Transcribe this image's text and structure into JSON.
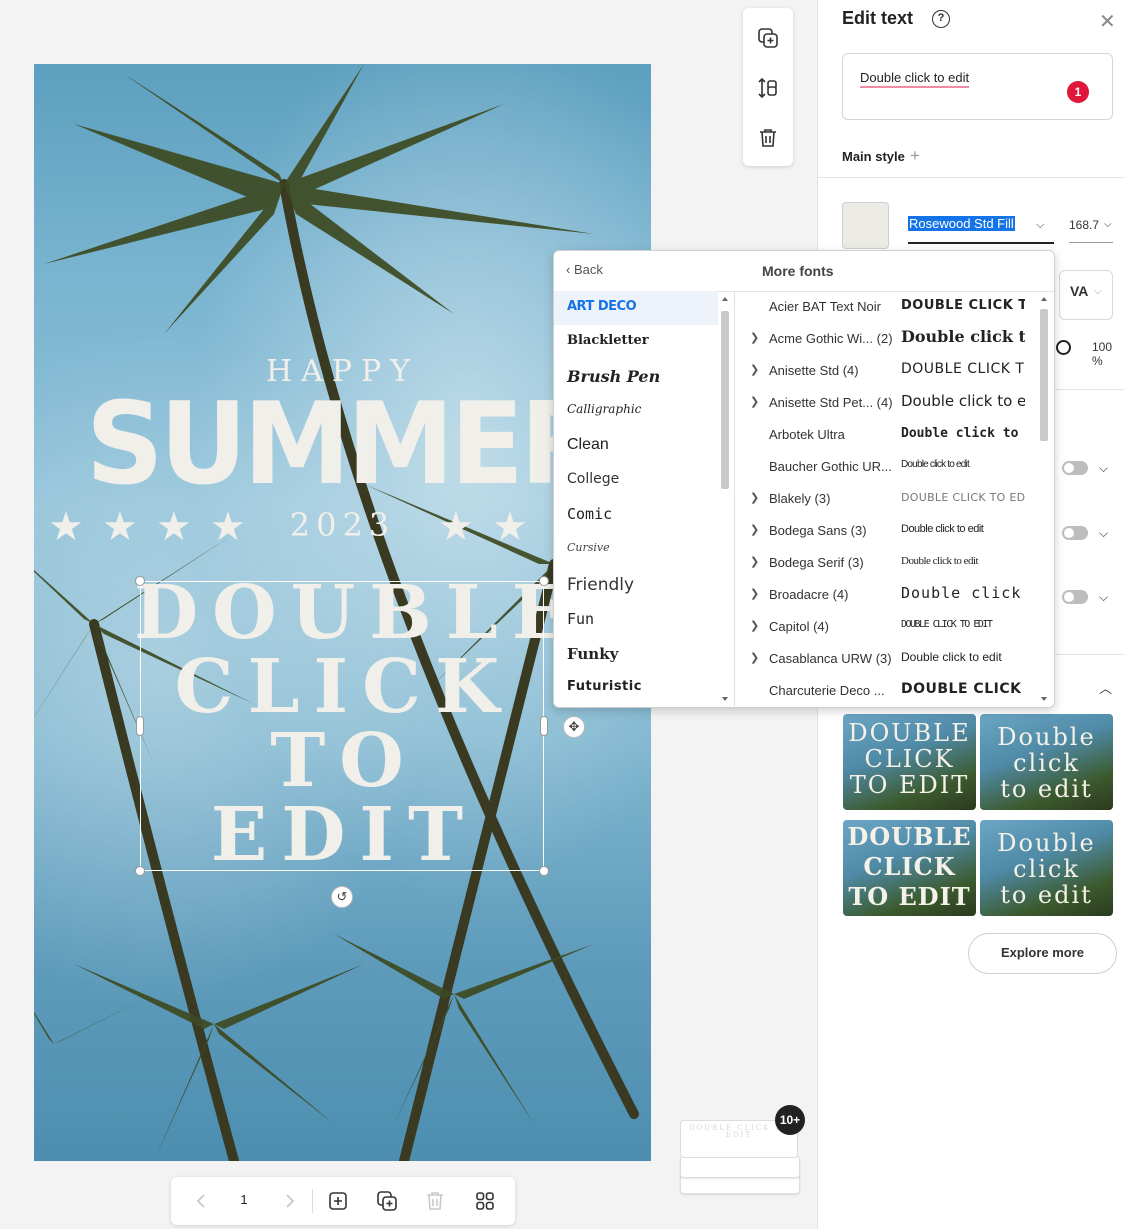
{
  "poster": {
    "happy": "HAPPY",
    "summer": "SUMMER",
    "year": "2023",
    "edit_lines": [
      "DOUBLE",
      "CLICK",
      "TO",
      "EDIT"
    ]
  },
  "toolbar": {
    "items": [
      {
        "name": "duplicate-element-icon"
      },
      {
        "name": "arrange-layers-icon"
      },
      {
        "name": "delete-icon"
      }
    ]
  },
  "page_bar": {
    "current_page": "1",
    "icons": [
      "prev-page-icon",
      "next-page-icon",
      "add-page-icon",
      "duplicate-page-icon",
      "delete-page-icon",
      "grid-view-icon"
    ]
  },
  "pages_stack": {
    "badge": "10+",
    "thumb_text": "DOUBLE CLICK TO EDIT"
  },
  "panel": {
    "title": "Edit text",
    "help_icon": "?",
    "text_value": "Double click to edit",
    "error_count": "1",
    "main_style_label": "Main style",
    "font_name": "Rosewood Std Fill",
    "font_size": "168.7",
    "kerning_label": "VA",
    "opacity": "100 %",
    "explore_more": "Explore more",
    "style_thumbs": [
      {
        "line1": "DOUBLE",
        "line2": "CLICK",
        "line3": "TO EDIT"
      },
      {
        "line1": "Double",
        "line2": "click",
        "line3": "to edit"
      },
      {
        "line1": "DOUBLE",
        "line2": "CLICK",
        "line3": "TO EDIT"
      },
      {
        "line1": "Double",
        "line2": "click",
        "line3": "to edit"
      }
    ]
  },
  "more_fonts": {
    "back_label": "Back",
    "title": "More fonts",
    "categories": [
      "ART DECO",
      "Blackletter",
      "Brush Pen",
      "Calligraphic",
      "Clean",
      "College",
      "Comic",
      "Cursive",
      "Friendly",
      "Fun",
      "Funky",
      "Futuristic"
    ],
    "active_category": "ART DECO",
    "fonts": [
      {
        "name": "Acier BAT Text Noir",
        "expandable": false,
        "preview": "DOUBLE CLICK TO"
      },
      {
        "name": "Acme Gothic Wi... (2)",
        "expandable": true,
        "preview": "Double click to"
      },
      {
        "name": "Anisette Std (4)",
        "expandable": true,
        "preview": "DOUBLE CLICK TO E"
      },
      {
        "name": "Anisette Std Pet... (4)",
        "expandable": true,
        "preview": "Double click to ed"
      },
      {
        "name": "Arbotek Ultra",
        "expandable": false,
        "preview": "Double click to e"
      },
      {
        "name": "Baucher Gothic UR...",
        "expandable": false,
        "preview": "Double click to edit"
      },
      {
        "name": "Blakely (3)",
        "expandable": true,
        "preview": "DOUBLE CLICK TO EDIT"
      },
      {
        "name": "Bodega Sans (3)",
        "expandable": true,
        "preview": "Double click to edit"
      },
      {
        "name": "Bodega Serif (3)",
        "expandable": true,
        "preview": "Double click to edit"
      },
      {
        "name": "Broadacre (4)",
        "expandable": true,
        "preview": "Double click t"
      },
      {
        "name": "Capitol (4)",
        "expandable": true,
        "preview": "DOUBLE CLICK TO EDIT"
      },
      {
        "name": "Casablanca URW (3)",
        "expandable": true,
        "preview": "Double click to edit"
      },
      {
        "name": "Charcuterie Deco ...",
        "expandable": false,
        "preview": "DOUBLE CLICK T"
      }
    ]
  },
  "colors": {
    "accent": "#1473e6",
    "error": "#e0163a",
    "text_color_swatch": "#ecebe5"
  }
}
